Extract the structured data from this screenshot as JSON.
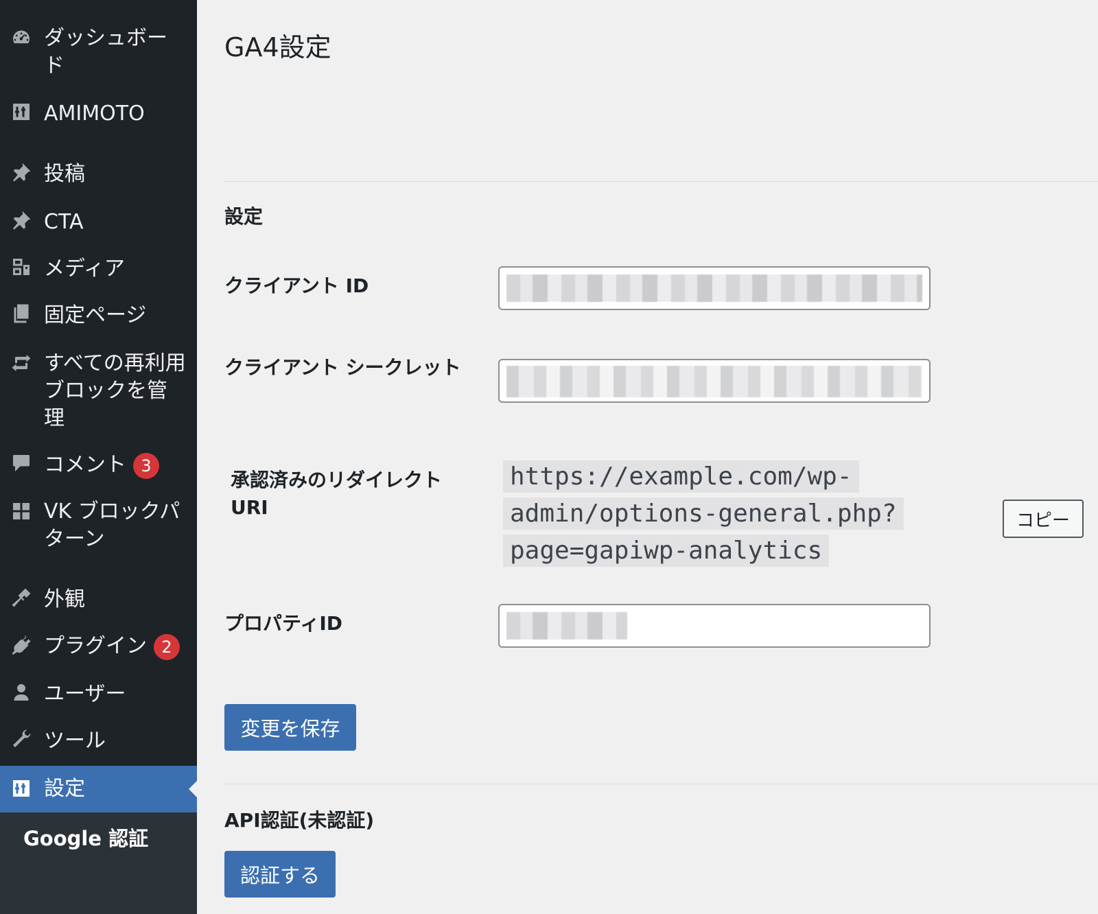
{
  "sidebar": {
    "items": [
      {
        "label": "ダッシュボード",
        "icon": "dashboard-icon"
      },
      {
        "label": "AMIMOTO",
        "icon": "settings-sliders-icon"
      },
      {
        "label": "投稿",
        "icon": "pin-icon"
      },
      {
        "label": "CTA",
        "icon": "pin-icon"
      },
      {
        "label": "メディア",
        "icon": "media-icon"
      },
      {
        "label": "固定ページ",
        "icon": "pages-icon"
      },
      {
        "label": "すべての再利用ブロックを管理",
        "icon": "reusable-blocks-icon"
      },
      {
        "label": "コメント",
        "icon": "comment-icon",
        "badge": "3"
      },
      {
        "label": "VK ブロックパターン",
        "icon": "grid-icon"
      },
      {
        "label": "外観",
        "icon": "appearance-brush-icon"
      },
      {
        "label": "プラグイン",
        "icon": "plugin-icon",
        "badge": "2"
      },
      {
        "label": "ユーザー",
        "icon": "user-icon"
      },
      {
        "label": "ツール",
        "icon": "wrench-icon"
      },
      {
        "label": "設定",
        "icon": "settings-sliders-icon",
        "current": true
      }
    ],
    "submenu": {
      "label": "Google 認証"
    }
  },
  "main": {
    "page_title": "GA4設定",
    "settings_heading": "設定",
    "client_id_label": "クライアント ID",
    "client_secret_label": "クライアント シークレット",
    "redirect_uri_label": "承認済みのリダイレクト URI",
    "redirect_uri_value": "https://example.com/wp-admin/options-general.php?page=gapiwp-analytics",
    "copy_button": "コピー",
    "property_id_label": "プロパティID",
    "save_button": "変更を保存",
    "api_heading": "API認証(未認証)",
    "auth_button": "認証する"
  },
  "colors": {
    "sidebar_bg": "#1d2327",
    "accent": "#3c6fb0",
    "badge": "#d63638",
    "page_bg": "#f0f0f1"
  }
}
